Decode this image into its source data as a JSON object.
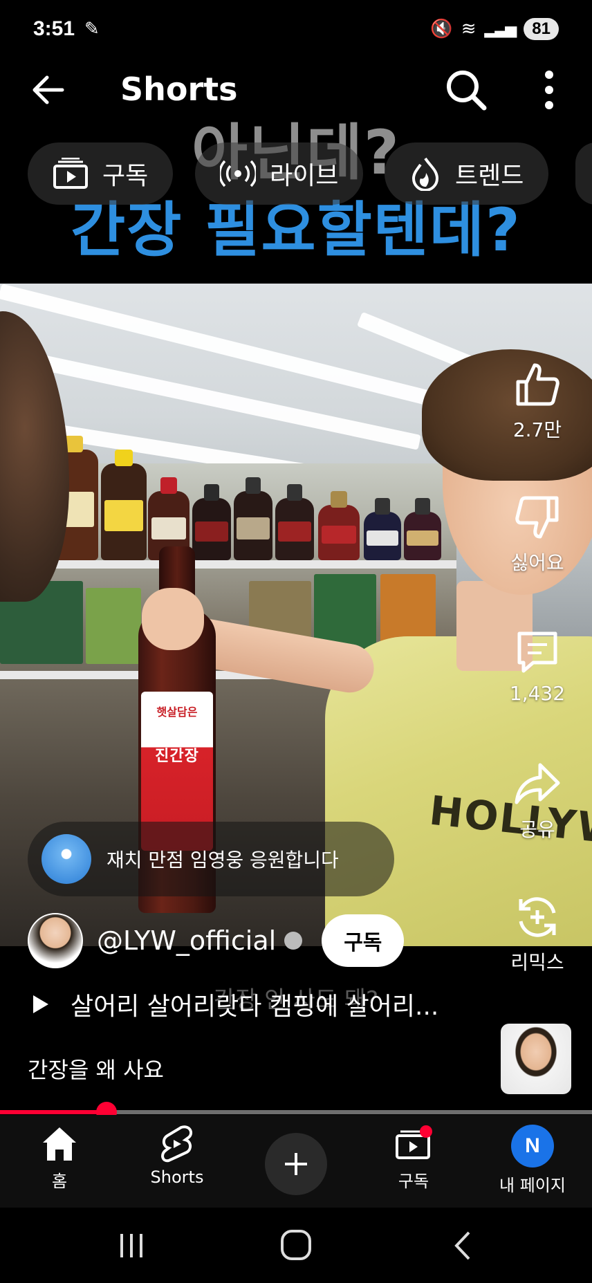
{
  "status_bar": {
    "time": "3:51",
    "battery": "81"
  },
  "top_bar": {
    "title": "Shorts"
  },
  "chips": [
    {
      "label": "구독",
      "icon": "subscriptions-icon"
    },
    {
      "label": "라이브",
      "icon": "live-icon"
    },
    {
      "label": "트렌드",
      "icon": "trending-icon"
    }
  ],
  "video": {
    "caption_top": "아닌데?",
    "caption_main": "간장 필요할텐데?",
    "caption_sub": "간장 안 사도 돼?",
    "bottle_brand": "햇살담은",
    "bottle_label": "진간장",
    "shirt_text": "HOLLYWOOD"
  },
  "actions": {
    "like_count": "2.7만",
    "dislike_label": "싫어요",
    "comment_count": "1,432",
    "share_label": "공유",
    "remix_label": "리믹스"
  },
  "comment_pill": {
    "text": "재치 만점 임영웅 응원합니다"
  },
  "channel": {
    "name": "@LYW_official",
    "subscribe_label": "구독"
  },
  "description": {
    "title": "살어리 살어리랏다 캠핑에 살어리...",
    "caption": "간장을 왜 사요"
  },
  "progress": {
    "fraction": 0.18
  },
  "bottom_nav": {
    "home": "홈",
    "shorts": "Shorts",
    "subscriptions": "구독",
    "profile": "내 페이지",
    "profile_initial": "N"
  },
  "colors": {
    "accent": "#ff0033",
    "caption_blue": "#2e8fe0",
    "avatar_blue": "#1a73e8"
  }
}
